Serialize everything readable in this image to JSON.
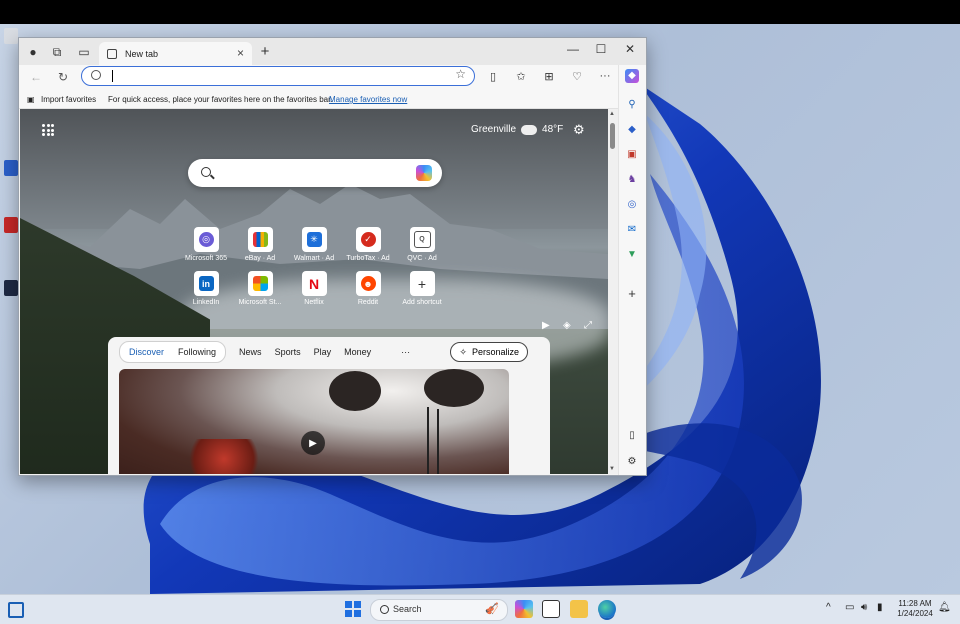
{
  "browser": {
    "tab_title": "New tab",
    "favorites_bar": {
      "import_label": "Import favorites",
      "hint": "For quick access, place your favorites here on the favorites bar.",
      "manage_link": "Manage favorites now"
    }
  },
  "newtab": {
    "weather": {
      "city": "Greenville",
      "temp": "48°F"
    },
    "shortcuts": [
      {
        "label": "Microsoft 365",
        "icon": "m365-icon",
        "color": "#6b5cd6"
      },
      {
        "label": "eBay · Ad",
        "icon": "ebay-icon",
        "color": "#2b2b2b"
      },
      {
        "label": "Walmart · Ad",
        "icon": "walmart-icon",
        "color": "#1e6fd9"
      },
      {
        "label": "TurboTax · Ad",
        "icon": "turbotax-icon",
        "color": "#d52b1e"
      },
      {
        "label": "QVC · Ad",
        "icon": "qvc-icon",
        "color": "#555555"
      },
      {
        "label": "LinkedIn",
        "icon": "linkedin-icon",
        "color": "#0a66c2"
      },
      {
        "label": "Microsoft St...",
        "icon": "msstore-icon",
        "color": "#f25022"
      },
      {
        "label": "Netflix",
        "icon": "netflix-icon",
        "color": "#e50914"
      },
      {
        "label": "Reddit",
        "icon": "reddit-icon",
        "color": "#ff4500"
      },
      {
        "label": "Add shortcut",
        "icon": "plus-icon",
        "color": "#333333"
      }
    ],
    "feed": {
      "tabs": [
        "Discover",
        "Following"
      ],
      "categories": [
        "News",
        "Sports",
        "Play",
        "Money"
      ],
      "more": "···",
      "personalize": "Personalize"
    }
  },
  "taskbar": {
    "search_label": "Search",
    "time": "11:28 AM",
    "date": "1/24/2024"
  }
}
